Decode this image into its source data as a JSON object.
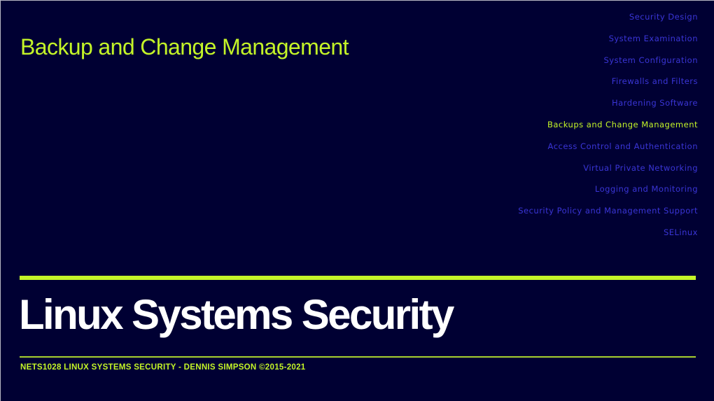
{
  "slide": {
    "section_title": "Backup and Change Management",
    "main_title": "Linux Systems Security",
    "footer": "NETS1028 LINUX SYSTEMS SECURITY - DENNIS SIMPSON ©2015-2021",
    "colors": {
      "background": "#000033",
      "accent": "#c4f428",
      "nav": "#3a35d6",
      "title": "#ffffff"
    }
  },
  "nav": {
    "items": [
      {
        "label": "Security Design",
        "active": false
      },
      {
        "label": "System Examination",
        "active": false
      },
      {
        "label": "System Configuration",
        "active": false
      },
      {
        "label": "Firewalls and Filters",
        "active": false
      },
      {
        "label": "Hardening Software",
        "active": false
      },
      {
        "label": "Backups and Change Management",
        "active": true
      },
      {
        "label": "Access Control and Authentication",
        "active": false
      },
      {
        "label": "Virtual Private Networking",
        "active": false
      },
      {
        "label": "Logging and Monitoring",
        "active": false
      },
      {
        "label": "Security Policy and Management Support",
        "active": false
      },
      {
        "label": "SELinux",
        "active": false
      }
    ]
  }
}
